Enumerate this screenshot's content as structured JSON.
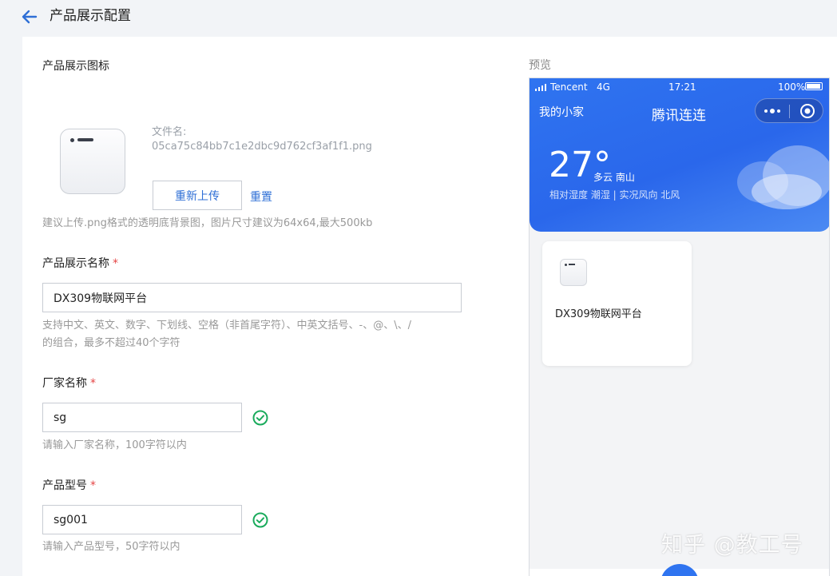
{
  "header": {
    "title": "产品展示配置",
    "back_icon": "arrow-left-icon"
  },
  "icon_section": {
    "label": "产品展示图标",
    "file_label": "文件名:",
    "file_name": "05ca75c84bb7c1e2dbc9d762cf3af1f1.png",
    "reupload_label": "重新上传",
    "reset_label": "重置",
    "hint": "建议上传.png格式的透明底背景图，图片尺寸建议为64x64,最大500kb"
  },
  "name_field": {
    "label": "产品展示名称",
    "required_mark": "*",
    "value": "DX309物联网平台",
    "hint_line1": "支持中文、英文、数字、下划线、空格（非首尾字符）、中英文括号、-、@、\\、/",
    "hint_line2": "的组合，最多不超过40个字符"
  },
  "vendor_field": {
    "label": "厂家名称",
    "required_mark": "*",
    "value": "sg",
    "hint": "请输入厂家名称，100字符以内"
  },
  "model_field": {
    "label": "产品型号",
    "required_mark": "*",
    "value": "sg001",
    "hint": "请输入产品型号，50字符以内"
  },
  "preview": {
    "label": "预览",
    "status_bar": {
      "carrier": "Tencent",
      "network": "4G",
      "time": "17:21",
      "battery": "100%"
    },
    "home_name": "我的小家",
    "app_title": "腾讯连连",
    "temperature": "27°",
    "weather": "多云 南山",
    "weather_detail": "相对湿度 潮湿  |  实况风向 北风",
    "card": {
      "name": "DX309物联网平台"
    }
  },
  "watermark": "知乎 @教工号",
  "colors": {
    "accent": "#2f6fd6",
    "success": "#1aab5c",
    "required": "#e54545",
    "phone_blue": "#2f74f0"
  }
}
